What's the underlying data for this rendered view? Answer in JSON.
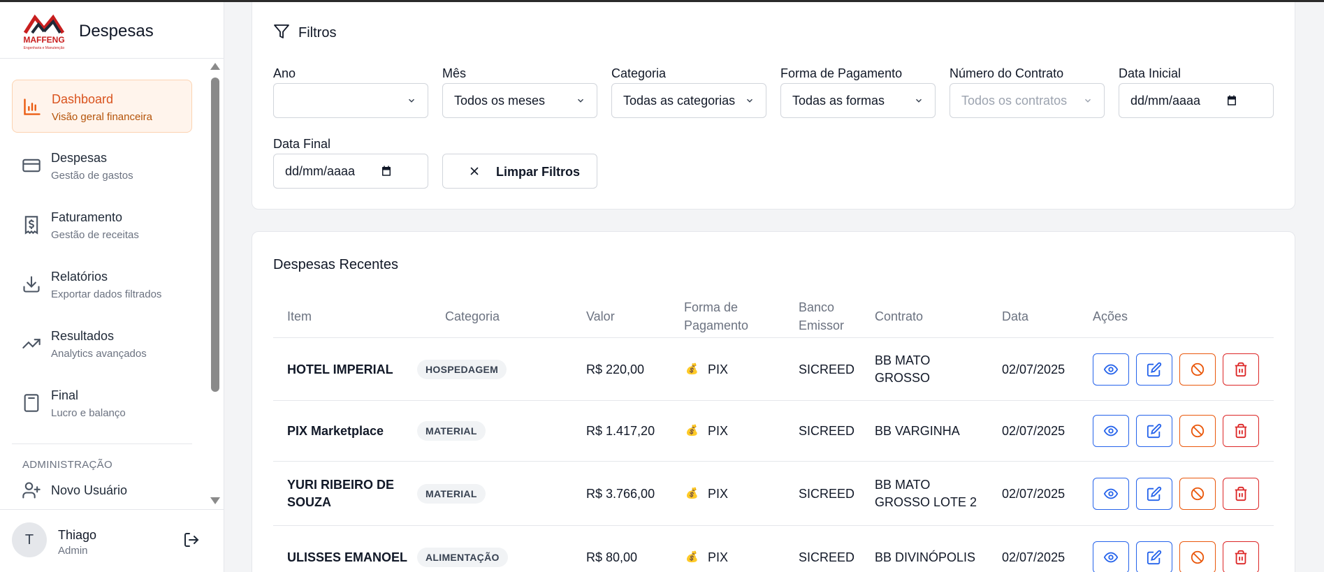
{
  "app": {
    "title": "Despesas",
    "logo_text": "MAFFENG",
    "logo_sub": "Engenharia e Manutenção"
  },
  "sidebar": {
    "items": [
      {
        "title": "Dashboard",
        "subtitle": "Visão geral financeira",
        "icon": "bar-chart-icon",
        "active": true
      },
      {
        "title": "Despesas",
        "subtitle": "Gestão de gastos",
        "icon": "credit-card-icon",
        "active": false
      },
      {
        "title": "Faturamento",
        "subtitle": "Gestão de receitas",
        "icon": "receipt-dollar-icon",
        "active": false
      },
      {
        "title": "Relatórios",
        "subtitle": "Exportar dados filtrados",
        "icon": "download-icon",
        "active": false
      },
      {
        "title": "Resultados",
        "subtitle": "Analytics avançados",
        "icon": "trending-up-icon",
        "active": false
      },
      {
        "title": "Final",
        "subtitle": "Lucro e balanço",
        "icon": "calculator-icon",
        "active": false
      }
    ],
    "admin_section": "ADMINISTRAÇÃO",
    "new_user": "Novo Usuário"
  },
  "user": {
    "initial": "T",
    "name": "Thiago",
    "role": "Admin"
  },
  "filters": {
    "title": "Filtros",
    "ano": {
      "label": "Ano",
      "value": ""
    },
    "mes": {
      "label": "Mês",
      "value": "Todos os meses"
    },
    "categoria": {
      "label": "Categoria",
      "value": "Todas as categorias"
    },
    "forma": {
      "label": "Forma de Pagamento",
      "value": "Todas as formas"
    },
    "contrato": {
      "label": "Número do Contrato",
      "value": "Todos os contratos"
    },
    "data_inicial": {
      "label": "Data Inicial",
      "value": "dd/mm/aaaa"
    },
    "data_final": {
      "label": "Data Final",
      "value": "dd/mm/aaaa"
    },
    "clear_label": "Limpar Filtros"
  },
  "table": {
    "title": "Despesas Recentes",
    "columns": {
      "item": "Item",
      "categoria": "Categoria",
      "valor": "Valor",
      "forma_1": "Forma de",
      "forma_2": "Pagamento",
      "banco_1": "Banco",
      "banco_2": "Emissor",
      "contrato": "Contrato",
      "data": "Data",
      "acoes": "Ações"
    },
    "rows": [
      {
        "item_1": "HOTEL IMPERIAL",
        "item_2": "",
        "categoria": "HOSPEDAGEM",
        "valor": "R$ 220,00",
        "forma": "PIX",
        "banco": "SICREED",
        "contrato_1": "BB MATO",
        "contrato_2": "GROSSO",
        "data": "02/07/2025"
      },
      {
        "item_1": "PIX Marketplace",
        "item_2": "",
        "categoria": "MATERIAL",
        "valor": "R$ 1.417,20",
        "forma": "PIX",
        "banco": "SICREED",
        "contrato_1": "BB VARGINHA",
        "contrato_2": "",
        "data": "02/07/2025"
      },
      {
        "item_1": "YURI RIBEIRO DE",
        "item_2": "SOUZA",
        "categoria": "MATERIAL",
        "valor": "R$ 3.766,00",
        "forma": "PIX",
        "banco": "SICREED",
        "contrato_1": "BB MATO",
        "contrato_2": "GROSSO LOTE 2",
        "data": "02/07/2025"
      },
      {
        "item_1": "ULISSES EMANOEL",
        "item_2": "",
        "categoria": "ALIMENTAÇÃO",
        "valor": "R$ 80,00",
        "forma": "PIX",
        "banco": "SICREED",
        "contrato_1": "BB DIVINÓPOLIS",
        "contrato_2": "",
        "data": "02/07/2025"
      }
    ],
    "pay_icon": "💰"
  },
  "colors": {
    "accent": "#ea580c",
    "blue": "#2563eb",
    "red": "#dc2626",
    "logo_red": "#c81e1e",
    "logo_dark": "#1f2937"
  }
}
